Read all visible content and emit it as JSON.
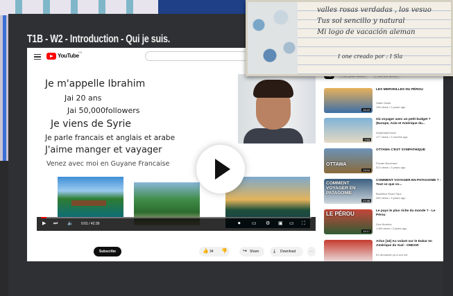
{
  "slide": {
    "title": "T1B - W2 - Introduction - Qui je suis."
  },
  "youtube": {
    "wordmark": "YouTube",
    "region": "FR",
    "video_lines": [
      "Je m'appelle Ibrahim",
      "Jai 20 ans",
      "Jai 50,000followers",
      "Je viens de Syrie",
      "Je parle francais et anglais et arabe",
      "J'aime manger et vayager",
      "Venez avec moi en Guyane Francaise"
    ],
    "time": "0:01 / 42:39",
    "progress": 0.02,
    "subscribe_label": "Subscribe",
    "likes": "34",
    "share_label": "Share",
    "download_label": "Download",
    "filters": [
      "All",
      "From your search",
      "From the series"
    ],
    "recommended": [
      {
        "title": "LES MERVEILLES DU PÉROU",
        "channel": "Visite Guide",
        "meta": "196 views • 3 years ago",
        "duration": "18:43",
        "overlay": "",
        "colors": [
          "#e9b15a",
          "#3c6fa8"
        ]
      },
      {
        "title": "Où voyager avec un petit budget ? (Europe, Asie et Amérique du...",
        "channel": "DollyDallyTravel",
        "meta": "177 views • 3 months ago",
        "duration": "7:53",
        "overlay": "",
        "colors": [
          "#7fb3d8",
          "#e5d9c2"
        ]
      },
      {
        "title": "OTTAWA C'EST SYMPATHIQUE",
        "channel": "Florian Bouchard",
        "meta": "513 views • 3 years ago",
        "duration": "13:04",
        "overlay": "OTTAWA",
        "colors": [
          "#6c93b8",
          "#8a6a3a"
        ]
      },
      {
        "title": "COMMENT VOYAGER EN PATAGONIE ? - Tout ce que vo...",
        "channel": "Backflow Road Trips",
        "meta": "289 views • 3 years ago",
        "duration": "17:48",
        "overlay": "COMMENT VOYAGER EN PATAGONIE",
        "colors": [
          "#3b5f80",
          "#cfd8de"
        ]
      },
      {
        "title": "Le pays le plus riche du monde ? - Le Pérou",
        "channel": "Dos Mundos",
        "meta": "1.5M views • 3 years ago",
        "duration": "13:17",
        "overlay": "LE PÉROU",
        "colors": [
          "#c7463b",
          "#2f5c34"
        ]
      },
      {
        "title": "Arlus [16] Au volant sur le Dakar en Amérique du Sud - ONDAR",
        "channel": "En demande ça à son mé",
        "meta": "",
        "duration": "",
        "overlay": "",
        "colors": [
          "#c53b2f",
          "#f0f0f0"
        ]
      }
    ]
  },
  "letter": {
    "lines": [
      "valles rosas verdadas , los vesuo",
      "Tus sol sencillo y natural",
      "Mi logo de vacación aleman",
      "I one creado por : I Sla"
    ]
  },
  "colors": {
    "accent_red": "#ff0000",
    "card_bg": "#2f3034",
    "bg_blue": "#1f3f86"
  }
}
